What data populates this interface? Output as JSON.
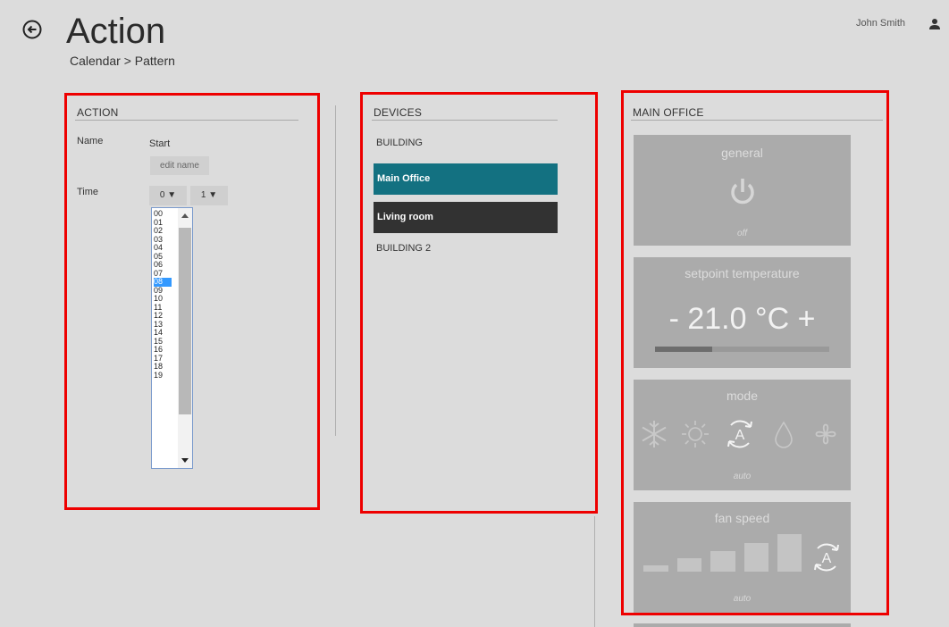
{
  "header": {
    "title": "Action",
    "breadcrumb": "Calendar > Pattern",
    "user_name": "John Smith"
  },
  "action_panel": {
    "heading": "ACTION",
    "name_label": "Name",
    "name_value": "Start",
    "edit_name_label": "edit name",
    "time_label": "Time",
    "hour_select_value": "0 ▼",
    "minute_select_value": "1 ▼",
    "hour_options": [
      "00",
      "01",
      "02",
      "03",
      "04",
      "05",
      "06",
      "07",
      "08",
      "09",
      "10",
      "11",
      "12",
      "13",
      "14",
      "15",
      "16",
      "17",
      "18",
      "19"
    ],
    "selected_hour": "08"
  },
  "devices_panel": {
    "heading": "DEVICES",
    "groups": [
      "BUILDING",
      "BUILDING 2"
    ],
    "items": [
      {
        "label": "Main Office",
        "color": "#137181"
      },
      {
        "label": "Living room",
        "color": "#323232"
      }
    ]
  },
  "main_office_panel": {
    "heading": "MAIN OFFICE",
    "general": {
      "title": "general",
      "state": "off",
      "icon": "power-icon"
    },
    "setpoint": {
      "title": "setpoint temperature",
      "value": "- 21.0 °C +",
      "bar_level": 0.33
    },
    "mode": {
      "title": "mode",
      "state": "auto",
      "icons": [
        "snowflake-icon",
        "sun-icon",
        "auto-mode-icon",
        "drop-icon",
        "fan-icon"
      ]
    },
    "fan_speed": {
      "title": "fan speed",
      "state": "auto",
      "levels": 5,
      "icon": "auto-mode-icon"
    }
  },
  "colors": {
    "annotation_red": "#ee0000",
    "selection_blue": "#3399ff",
    "card_gray": "#ababab",
    "device_selected": "#137181",
    "device_dark": "#323232"
  }
}
